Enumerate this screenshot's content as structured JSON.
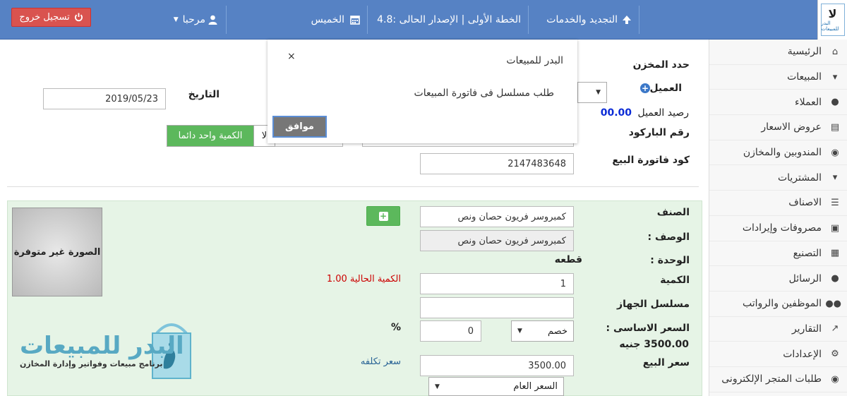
{
  "topbar": {
    "logout_label": "تسجيل خروج",
    "user_label": "مرحبا",
    "day_label": "الخميس",
    "plan_label": "الخطة الأولى | الإصدار الحالى :4.8",
    "renew_label": "التجديد والخدمات",
    "logo_text": "البدر للمبيعات"
  },
  "sidebar": {
    "items": [
      {
        "label": "الرئيسية",
        "icon": "home-icon"
      },
      {
        "label": "المبيعات",
        "icon": "cart-icon"
      },
      {
        "label": "العملاء",
        "icon": "user-icon"
      },
      {
        "label": "عروض الاسعار",
        "icon": "list-alt-icon"
      },
      {
        "label": "المندوبين والمخازن",
        "icon": "globe-icon"
      },
      {
        "label": "المشتريات",
        "icon": "cart-plus-icon"
      },
      {
        "label": "الاصناف",
        "icon": "list-icon"
      },
      {
        "label": "مصروفات وإيرادات",
        "icon": "money-icon"
      },
      {
        "label": "التصنيع",
        "icon": "factory-icon"
      },
      {
        "label": "الرسائل",
        "icon": "comments-icon"
      },
      {
        "label": "الموظفين والرواتب",
        "icon": "users-icon"
      },
      {
        "label": "التقارير",
        "icon": "chart-icon"
      },
      {
        "label": "الإعدادات",
        "icon": "cogs-icon"
      },
      {
        "label": "طلبات المتجر الإلكترونى",
        "icon": "globe-icon"
      }
    ]
  },
  "form": {
    "warehouse_label": "حدد المخزن",
    "customer_label": "العميل",
    "date_label": "التاريخ",
    "date_value": "2019/05/23",
    "balance_label": "رصيد العميل",
    "balance_value": "00.00",
    "barcode_label": "رقم الباركود",
    "qty_one_label": "الكمية واحد دائما",
    "no_label": "لا",
    "invoice_code_label": "كود فاتورة البيع",
    "invoice_code_value": "2147483648"
  },
  "item": {
    "category_label": "الصنف",
    "category_value": "كمبروسر فريون حصان ونص",
    "desc_label": "الوصف :",
    "desc_value": "كمبروسر فريون حصان ونص",
    "unit_label": "الوحدة :",
    "unit_value": "قطعه",
    "qty_label": "الكمية",
    "qty_value": "1",
    "current_qty_label": "الكمية الحالية 1.00",
    "serial_label": "مسلسل الجهاز",
    "base_price_label": "السعر الاساسى :",
    "base_price_value": "3500.00 جنيه",
    "discount_type": "خصم",
    "discount_value": "0",
    "percent_label": "%",
    "sale_price_label": "سعر البيع",
    "sale_price_value": "3500.00",
    "cost_price_link": "سعر تكلفه",
    "price_list": "السعر العام",
    "image_placeholder": "الصورة غير متوفرة"
  },
  "brand": {
    "name": "البدر للمبيعات",
    "tagline": "برنامج مبيعات وفواتير وإدارة المخازن"
  },
  "modal": {
    "title": "البدر للمبيعات",
    "close": "×",
    "message": "طلب مسلسل فى فاتورة المبيعات",
    "ok_label": "موافق"
  }
}
